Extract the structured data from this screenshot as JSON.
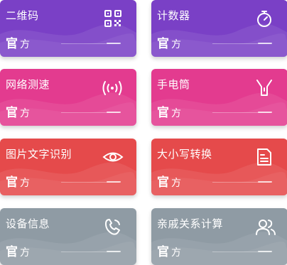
{
  "cards": [
    {
      "title": "二维码",
      "badge_main": "官",
      "badge_sub": "方",
      "icon": "qr-code-icon",
      "color": "#7b3fc4"
    },
    {
      "title": "计数器",
      "badge_main": "官",
      "badge_sub": "方",
      "icon": "stopwatch-icon",
      "color": "#7b3fc4"
    },
    {
      "title": "网络测速",
      "badge_main": "官",
      "badge_sub": "方",
      "icon": "wireless-signal-icon",
      "color": "#e23a8f"
    },
    {
      "title": "手电筒",
      "badge_main": "官",
      "badge_sub": "方",
      "icon": "flashlight-icon",
      "color": "#e23a8f"
    },
    {
      "title": "图片文字识别",
      "badge_main": "官",
      "badge_sub": "方",
      "icon": "eye-icon",
      "color": "#e4494b"
    },
    {
      "title": "大小写转换",
      "badge_main": "官",
      "badge_sub": "方",
      "icon": "document-icon",
      "color": "#e4494b"
    },
    {
      "title": "设备信息",
      "badge_main": "官",
      "badge_sub": "方",
      "icon": "phone-device-icon",
      "color": "#8e9aa3"
    },
    {
      "title": "亲戚关系计算",
      "badge_main": "官",
      "badge_sub": "方",
      "icon": "users-icon",
      "color": "#8e9aa3"
    }
  ]
}
